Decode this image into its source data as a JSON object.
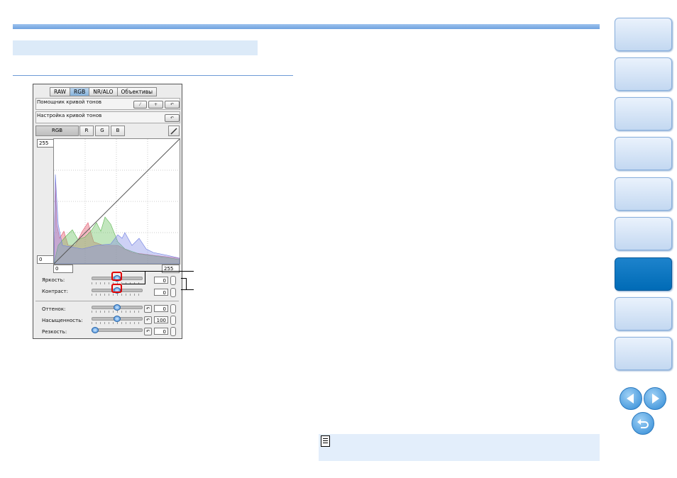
{
  "tabs": [
    "RAW",
    "RGB",
    "NR/ALO",
    "Объективы"
  ],
  "selected_tab": "RGB",
  "curve_assist": {
    "label": "Помощник кривой тонов"
  },
  "curve_adjust": {
    "label": "Настройка кривой тонов"
  },
  "channels": [
    "RGB",
    "R",
    "G",
    "B"
  ],
  "graph": {
    "input_max": "255",
    "input_min": "0",
    "output_min": "0",
    "output_max": "255"
  },
  "sliders": {
    "brightness": {
      "label": "Яркость:",
      "value": "0"
    },
    "contrast": {
      "label": "Контраст:",
      "value": "0"
    },
    "hue": {
      "label": "Оттенок:",
      "value": "0"
    },
    "saturation": {
      "label": "Насыщенность:",
      "value": "100"
    },
    "sharpness": {
      "label": "Резкость:",
      "value": "0"
    }
  },
  "colors": {
    "active_nav": "#006bb6",
    "accent": "#6fa2df",
    "highlight": "#e00000"
  }
}
